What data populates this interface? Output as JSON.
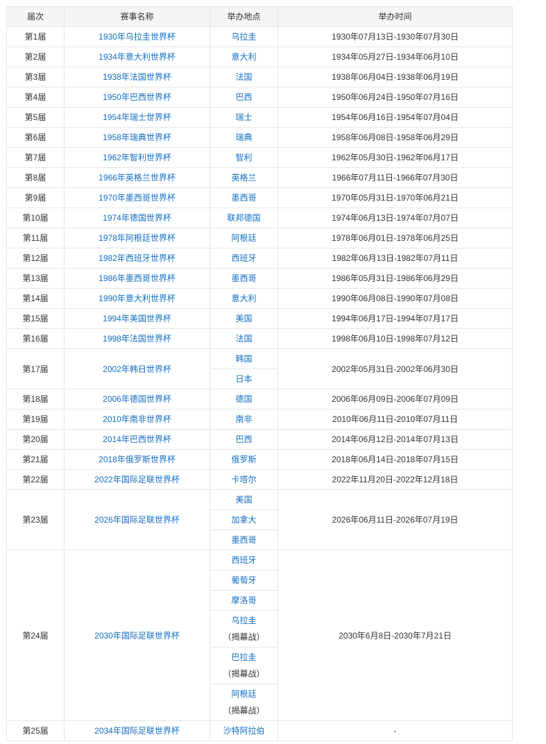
{
  "headers": [
    "届次",
    "赛事名称",
    "举办地点",
    "举办时间"
  ],
  "rows": [
    {
      "edition": "第1届",
      "name": "1930年乌拉圭世界杯",
      "hosts": [
        {
          "name": "乌拉圭"
        }
      ],
      "dates": "1930年07月13日-1930年07月30日"
    },
    {
      "edition": "第2届",
      "name": "1934年意大利世界杯",
      "hosts": [
        {
          "name": "意大利"
        }
      ],
      "dates": "1934年05月27日-1934年06月10日"
    },
    {
      "edition": "第3届",
      "name": "1938年法国世界杯",
      "hosts": [
        {
          "name": "法国"
        }
      ],
      "dates": "1938年06月04日-1938年06月19日"
    },
    {
      "edition": "第4届",
      "name": "1950年巴西世界杯",
      "hosts": [
        {
          "name": "巴西"
        }
      ],
      "dates": "1950年06月24日-1950年07月16日"
    },
    {
      "edition": "第5届",
      "name": "1954年瑞士世界杯",
      "hosts": [
        {
          "name": "瑞士"
        }
      ],
      "dates": "1954年06月16日-1954年07月04日"
    },
    {
      "edition": "第6届",
      "name": "1958年瑞典世界杯",
      "hosts": [
        {
          "name": "瑞典"
        }
      ],
      "dates": "1958年06月08日-1958年06月29日"
    },
    {
      "edition": "第7届",
      "name": "1962年智利世界杯",
      "hosts": [
        {
          "name": "智利"
        }
      ],
      "dates": "1962年05月30日-1962年06月17日"
    },
    {
      "edition": "第8届",
      "name": "1966年英格兰世界杯",
      "hosts": [
        {
          "name": "英格兰"
        }
      ],
      "dates": "1966年07月11日-1966年07月30日"
    },
    {
      "edition": "第9届",
      "name": "1970年墨西哥世界杯",
      "hosts": [
        {
          "name": "墨西哥"
        }
      ],
      "dates": "1970年05月31日-1970年06月21日"
    },
    {
      "edition": "第10届",
      "name": "1974年德国世界杯",
      "hosts": [
        {
          "name": "联邦德国"
        }
      ],
      "dates": "1974年06月13日-1974年07月07日"
    },
    {
      "edition": "第11届",
      "name": "1978年阿根廷世界杯",
      "hosts": [
        {
          "name": "阿根廷"
        }
      ],
      "dates": "1978年06月01日-1978年06月25日"
    },
    {
      "edition": "第12届",
      "name": "1982年西班牙世界杯",
      "hosts": [
        {
          "name": "西班牙"
        }
      ],
      "dates": "1982年06月13日-1982年07月11日"
    },
    {
      "edition": "第13届",
      "name": "1986年墨西哥世界杯",
      "hosts": [
        {
          "name": "墨西哥"
        }
      ],
      "dates": "1986年05月31日-1986年06月29日"
    },
    {
      "edition": "第14届",
      "name": "1990年意大利世界杯",
      "hosts": [
        {
          "name": "意大利"
        }
      ],
      "dates": "1990年06月08日-1990年07月08日"
    },
    {
      "edition": "第15届",
      "name": "1994年美国世界杯",
      "hosts": [
        {
          "name": "美国"
        }
      ],
      "dates": "1994年06月17日-1994年07月17日"
    },
    {
      "edition": "第16届",
      "name": "1998年法国世界杯",
      "hosts": [
        {
          "name": "法国"
        }
      ],
      "dates": "1998年06月10日-1998年07月12日"
    },
    {
      "edition": "第17届",
      "name": "2002年韩日世界杯",
      "hosts": [
        {
          "name": "韩国"
        },
        {
          "name": "日本"
        }
      ],
      "dates": "2002年05月31日-2002年06月30日"
    },
    {
      "edition": "第18届",
      "name": "2006年德国世界杯",
      "hosts": [
        {
          "name": "德国"
        }
      ],
      "dates": "2006年06月09日-2006年07月09日"
    },
    {
      "edition": "第19届",
      "name": "2010年南非世界杯",
      "hosts": [
        {
          "name": "南非"
        }
      ],
      "dates": "2010年06月11日-2010年07月11日"
    },
    {
      "edition": "第20届",
      "name": "2014年巴西世界杯",
      "hosts": [
        {
          "name": "巴西"
        }
      ],
      "dates": "2014年06月12日-2014年07月13日"
    },
    {
      "edition": "第21届",
      "name": "2018年俄罗斯世界杯",
      "hosts": [
        {
          "name": "俄罗斯"
        }
      ],
      "dates": "2018年06月14日-2018年07月15日"
    },
    {
      "edition": "第22届",
      "name": "2022年国际足联世界杯",
      "hosts": [
        {
          "name": "卡塔尔"
        }
      ],
      "dates": "2022年11月20日-2022年12月18日"
    },
    {
      "edition": "第23届",
      "name": "2026年国际足联世界杯",
      "hosts": [
        {
          "name": "美国"
        },
        {
          "name": "加拿大"
        },
        {
          "name": "墨西哥"
        }
      ],
      "dates": "2026年06月11日-2026年07月19日"
    },
    {
      "edition": "第24届",
      "name": "2030年国际足联世界杯",
      "hosts": [
        {
          "name": "西班牙"
        },
        {
          "name": "葡萄牙"
        },
        {
          "name": "摩洛哥"
        },
        {
          "name": "乌拉圭",
          "note": "（揭幕战）"
        },
        {
          "name": "巴拉圭",
          "note": "（揭幕战）"
        },
        {
          "name": "阿根廷",
          "note": "（揭幕战）"
        }
      ],
      "dates": "2030年6月8日-2030年7月21日"
    },
    {
      "edition": "第25届",
      "name": "2034年国际足联世界杯",
      "hosts": [
        {
          "name": "沙特阿拉伯"
        }
      ],
      "dates": "-"
    }
  ]
}
